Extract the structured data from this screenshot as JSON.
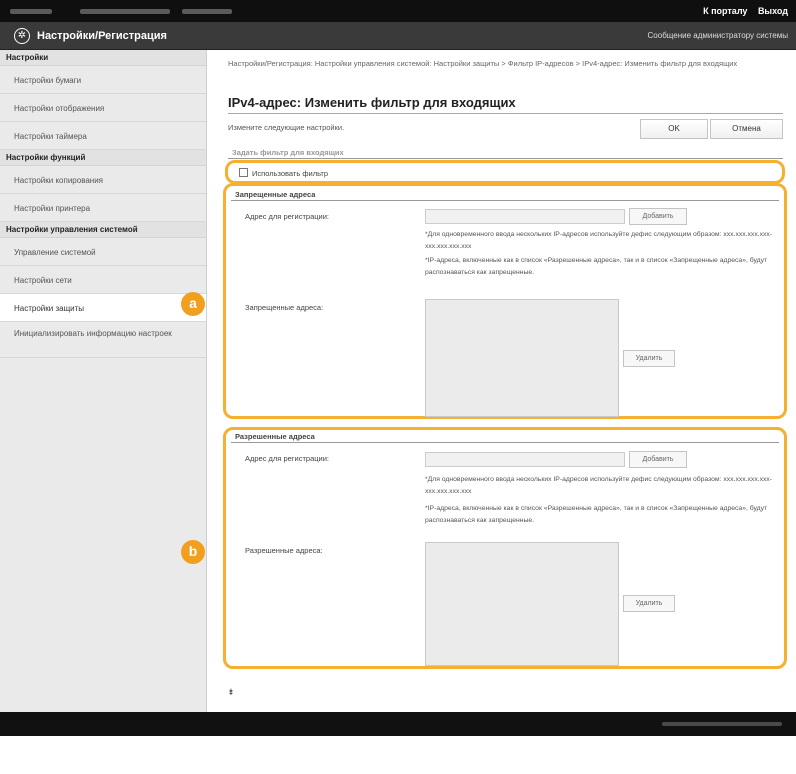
{
  "topbar": {
    "portal_link": "К порталу",
    "logout_link": "Выход"
  },
  "titlebar": {
    "title": "Настройки/Регистрация",
    "message_link": "Сообщение администратору системы"
  },
  "sidebar": {
    "groups": [
      {
        "header": "Настройки",
        "items": [
          "Настройки бумаги",
          "Настройки отображения",
          "Настройки таймера"
        ]
      },
      {
        "header": "Настройки функций",
        "items": [
          "Настройки копирования",
          "Настройки принтера"
        ]
      },
      {
        "header": "Настройки управления системой",
        "items": [
          "Управление системой",
          "Настройки сети",
          "Настройки защиты",
          "Инициализировать информацию настроек"
        ]
      }
    ],
    "active_item": "Настройки защиты"
  },
  "main": {
    "breadcrumb": "Настройки/Регистрация: Настройки управления системой: Настройки защиты > Фильтр IP-адресов > IPv4-адрес: Изменить фильтр для входящих",
    "heading": "IPv4-адрес: Изменить фильтр для входящих",
    "instruction": "Измените следующие настройки.",
    "ok_label": "OK",
    "cancel_label": "Отмена",
    "filter_section_title": "Задать фильтр для входящих",
    "use_filter_label": "Использовать фильтр",
    "use_filter_checked": false,
    "denied": {
      "title": "Запрещенные адреса",
      "register_label": "Адрес для регистрации:",
      "add_label": "Добавить",
      "note1": "*Для одновременного ввода нескольких IP-адресов используйте дефис следующим образом: xxx.xxx.xxx.xxx-xxx.xxx.xxx.xxx",
      "note2": "*IP-адреса, включенные как в список «Разрешенные адреса», так и в список «Запрещенные адреса», будут распознаваться как запрещенные.",
      "list_label": "Запрещенные адреса:",
      "delete_label": "Удалить",
      "marker": "a"
    },
    "allowed": {
      "title": "Разрешенные адреса",
      "register_label": "Адрес для регистрации:",
      "add_label": "Добавить",
      "note1": "*Для одновременного ввода нескольких IP-адресов используйте дефис следующим образом: xxx.xxx.xxx.xxx-xxx.xxx.xxx.xxx",
      "note2": "*IP-адреса, включенные как в список «Разрешенные адреса», так и в список «Запрещенные адреса», будут распознаваться как запрещенные.",
      "list_label": "Разрешенные адреса:",
      "delete_label": "Удалить",
      "marker": "b"
    },
    "totop_icon": "page-top-icon",
    "totop_glyph": "⯒"
  },
  "colors": {
    "highlight": "#f5b030",
    "marker": "#f29e1f",
    "topbar": "#0f0f0f",
    "titlebar": "#3a3a3a"
  }
}
